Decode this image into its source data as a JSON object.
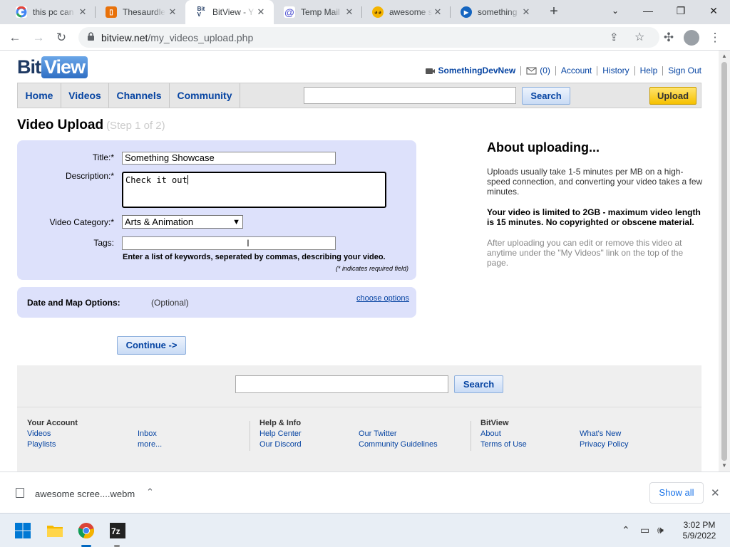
{
  "browser": {
    "tabs": [
      {
        "title": "this pc can",
        "icon": "google-g-icon",
        "active": false
      },
      {
        "title": "Thesaurdle",
        "icon": "book-icon",
        "active": false
      },
      {
        "title": "BitView - Y",
        "icon": "bitview-icon",
        "active": true
      },
      {
        "title": "Temp Mail",
        "icon": "at-sign-icon",
        "active": false
      },
      {
        "title": "awesome s",
        "icon": "face-icon",
        "active": false
      },
      {
        "title": "something",
        "icon": "video-icon",
        "active": false
      }
    ],
    "url_host": "bitview.net",
    "url_path": "/my_videos_upload.php"
  },
  "site": {
    "logo_bit": "Bit",
    "logo_view": "View",
    "user": {
      "username": "SomethingDevNew",
      "inbox_count": "(0)",
      "links": [
        "Account",
        "History",
        "Help",
        "Sign Out"
      ]
    },
    "nav": {
      "tabs": [
        "Home",
        "Videos",
        "Channels",
        "Community"
      ],
      "search_button": "Search",
      "upload_button": "Upload"
    }
  },
  "upload": {
    "title": "Video Upload",
    "step": "(Step 1 of 2)",
    "fields": {
      "title_label": "Title:*",
      "title_value": "Something Showcase",
      "description_label": "Description:*",
      "description_value": "Check it out",
      "category_label": "Video Category:*",
      "category_value": "Arts & Animation",
      "tags_label": "Tags:",
      "tags_value": "",
      "tags_hint": "Enter a list of keywords, seperated by commas, describing your video.",
      "required_note": "(* indicates required field)"
    },
    "options": {
      "label": "Date and Map Options:",
      "optional": "(Optional)",
      "link": "choose options"
    },
    "continue_button": "Continue ->"
  },
  "aside": {
    "title": "About uploading...",
    "p1": "Uploads usually take 1-5 minutes per MB on a high-speed connection, and converting your video takes a few minutes.",
    "p2": "Your video is limited to 2GB - maximum video length is 15 minutes. No copyrighted or obscene material.",
    "p3": "After uploading you can edit or remove this video at anytime under the \"My Videos\" link on the top of the page."
  },
  "footer": {
    "search_button": "Search",
    "columns": [
      {
        "heading": "Your Account",
        "links": [
          "Videos",
          "Playlists",
          "Inbox",
          "more..."
        ]
      },
      {
        "heading": "Help & Info",
        "links": [
          "Help Center",
          "Our Discord",
          "Our Twitter",
          "Community Guidelines"
        ]
      },
      {
        "heading": "BitView",
        "links": [
          "About",
          "Terms of Use",
          "What's New",
          "Privacy Policy"
        ]
      }
    ]
  },
  "downloads": {
    "file": "awesome scree....webm",
    "show_all": "Show all"
  },
  "taskbar": {
    "time": "3:02 PM",
    "date": "5/9/2022"
  },
  "colors": {
    "link": "#0644a2",
    "form_bg": "#dde1fb",
    "upload_btn": "#f6c100"
  }
}
